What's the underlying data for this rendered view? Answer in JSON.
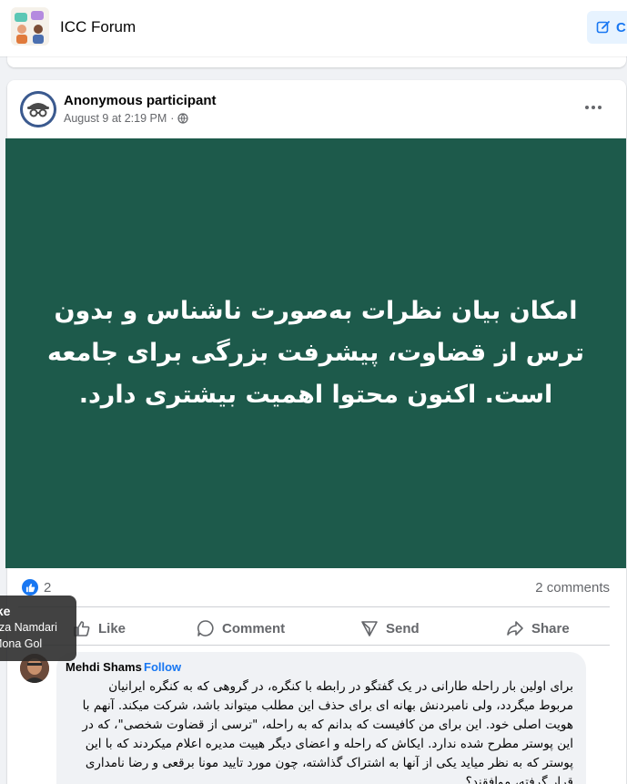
{
  "topbar": {
    "group_name": "ICC Forum",
    "create_label": "C"
  },
  "post": {
    "author": "Anonymous participant",
    "timestamp": "August 9 at 2:19 PM",
    "meta_separator": "·",
    "image_text": "امکان بیان نظرات به‌صورت ناشناس و بدون ترس از قضاوت، پیشرفت بزرگی برای جامعه است. اکنون محتوا اهمیت بیشتری دارد.",
    "image_bg_color": "#1d5a4b",
    "reaction_count": "2",
    "comments_count": "2 comments",
    "actions": {
      "like": "Like",
      "comment": "Comment",
      "send": "Send",
      "share": "Share"
    }
  },
  "tooltip": {
    "title": "ike",
    "names": [
      "eza Namdari",
      "Mona Gol"
    ]
  },
  "comment": {
    "author": "Mehdi Shams",
    "separator": "·",
    "follow_label": "Follow",
    "text": "برای اولین بار راحله طارانی در یک گفتگو در رابطه با کنگره، در گروهی که به کنگره ایرانیان مربوط میگردد، ولی نامبردنش بهانه ای برای حذف این مطلب میتواند باشد، شرکت میکند. آنهم با هویت اصلی خود. این برای من کافیست که بدانم که به راحله، \"ترسی از قضاوت شخصی\"، که در این پوستر مطرح شده ندارد. ایکاش که راحله و اعضای دیگر هییت مدیره اعلام میکردند که با این پوستر که به نظر میاید یکی از آنها به اشتراک گذاشته، چون مورد تایید مونا برقعی و رضا نامداری قرار گرفته، موافقند؟"
  },
  "colors": {
    "accent": "#1877f2",
    "muted_text": "#65676b",
    "page_bg": "#f0f2f5"
  },
  "icons": [
    "group-avatar",
    "edit-icon",
    "anonymous-avatar-icon",
    "globe-icon",
    "more-icon",
    "like-reaction-icon",
    "like-icon",
    "comment-icon",
    "send-icon",
    "share-icon"
  ]
}
